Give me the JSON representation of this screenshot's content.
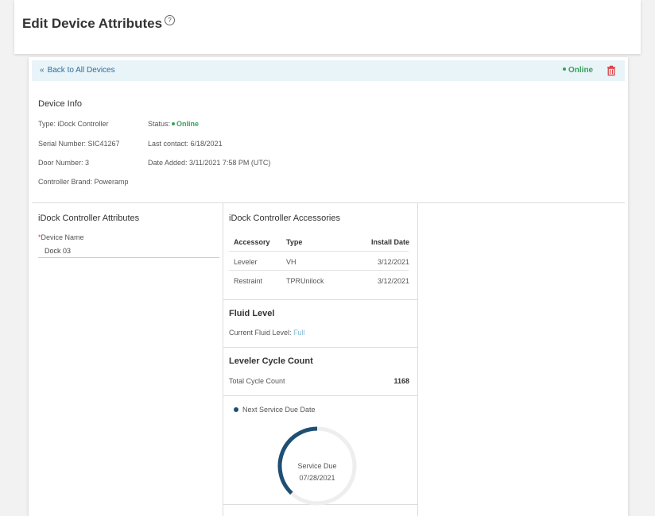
{
  "page": {
    "title": "Edit Device Attributes",
    "help_icon": "question-circle-icon"
  },
  "topbar": {
    "back_label": "Back to All Devices",
    "status_label": "Online",
    "status_color": "#3aa05a"
  },
  "device_info": {
    "heading": "Device Info",
    "type": "Type: iDock Controller",
    "serial": "Serial Number: SIC41267",
    "door": "Door Number: 3",
    "brand": "Controller Brand: Poweramp",
    "status_label": "Status:",
    "status_value": "Online",
    "last_contact": "Last contact: 6/18/2021",
    "date_added": "Date Added: 3/11/2021 7:58 PM (UTC)"
  },
  "attributes": {
    "heading": "iDock Controller Attributes",
    "device_name_label": "Device Name",
    "device_name_value": "Dock 03"
  },
  "accessories": {
    "heading": "iDock Controller Accessories",
    "columns": [
      "Accessory",
      "Type",
      "Install Date"
    ],
    "rows": [
      {
        "accessory": "Leveler",
        "type": "VH",
        "install_date": "3/12/2021"
      },
      {
        "accessory": "Restraint",
        "type": "TPRUnilock",
        "install_date": "3/12/2021"
      }
    ]
  },
  "fluid": {
    "heading": "Fluid Level",
    "label": "Current Fluid Level:",
    "value": "Full"
  },
  "cycle": {
    "heading": "Leveler Cycle Count",
    "label": "Total Cycle Count",
    "value": "1168"
  },
  "service": {
    "legend": "Next Service Due Date",
    "center_label": "Service Due",
    "center_date": "07/28/2021",
    "progress": 0.38,
    "arc_color": "#1f4f73",
    "track_color": "#eeeeee"
  }
}
